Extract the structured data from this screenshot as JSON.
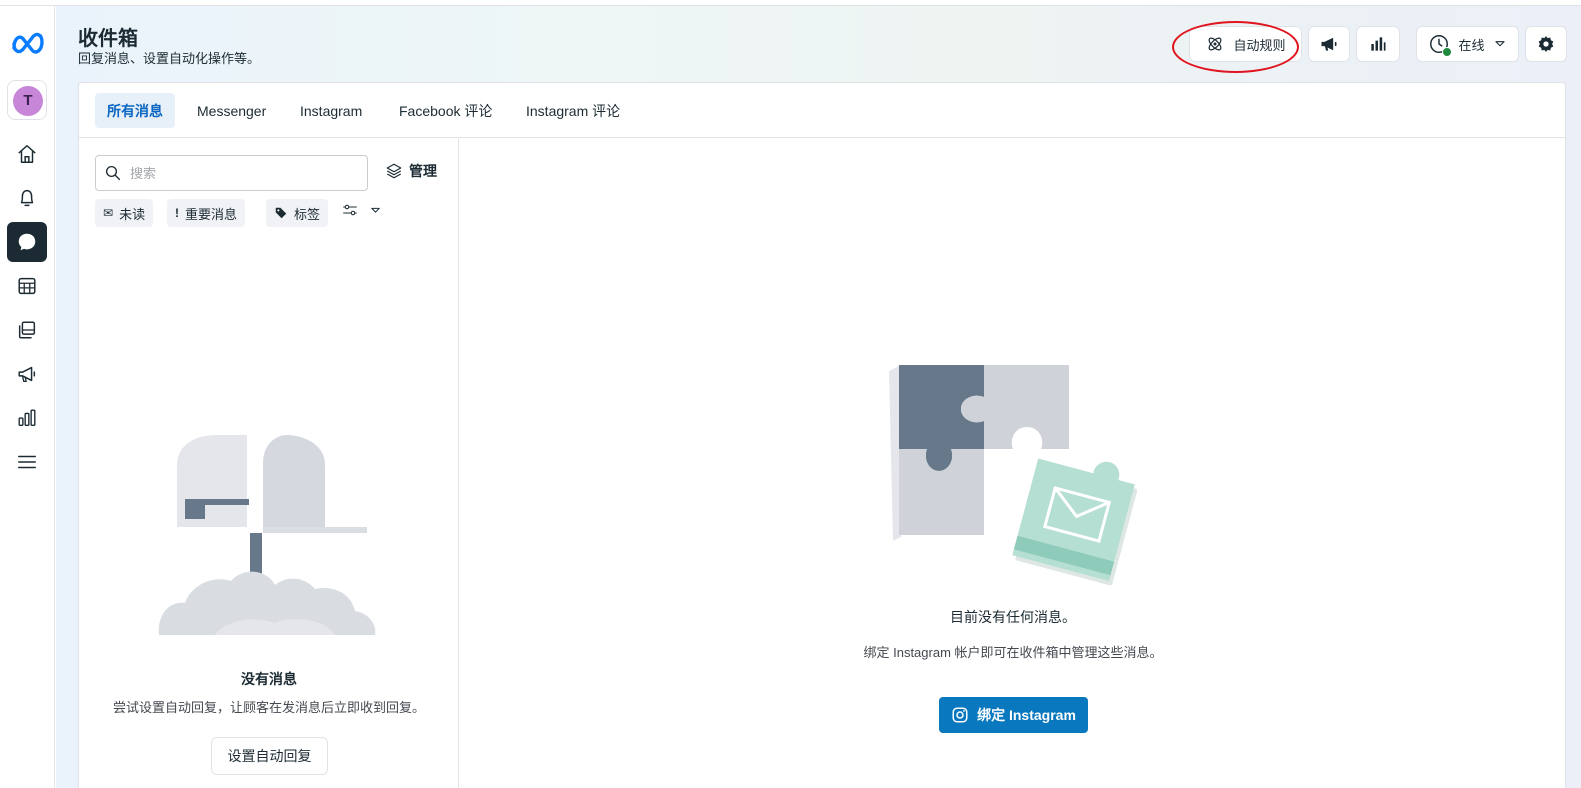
{
  "header": {
    "title": "收件箱",
    "subtitle": "回复消息、设置自动化操作等。",
    "automation_label": "自动规则",
    "status_label": "在线"
  },
  "sidebar": {
    "avatar_letter": "T",
    "items": [
      {
        "icon": "home-icon"
      },
      {
        "icon": "bell-icon"
      },
      {
        "icon": "inbox-chat-icon",
        "active": true
      },
      {
        "icon": "table-icon"
      },
      {
        "icon": "pages-icon"
      },
      {
        "icon": "megaphone-icon"
      },
      {
        "icon": "insights-icon"
      },
      {
        "icon": "menu-icon"
      }
    ]
  },
  "tabs": [
    {
      "label": "所有消息",
      "active": true
    },
    {
      "label": "Messenger"
    },
    {
      "label": "Instagram"
    },
    {
      "label": "Facebook 评论"
    },
    {
      "label": "Instagram 评论"
    }
  ],
  "list": {
    "search_placeholder": "搜索",
    "manage_label": "管理",
    "filters": [
      {
        "glyph": "✉",
        "label": "未读"
      },
      {
        "glyph": "!",
        "label": "重要消息"
      },
      {
        "glyph": "tag-icon",
        "label": "标签"
      }
    ],
    "empty_title": "没有消息",
    "empty_subtitle": "尝试设置自动回复，让顾客在发消息后立即收到回复。",
    "auto_reply_button": "设置自动回复"
  },
  "conversation": {
    "empty_title": "目前没有任何消息。",
    "empty_subtitle": "绑定 Instagram 帐户即可在收件箱中管理这些消息。",
    "bind_button": "绑定 Instagram"
  },
  "colors": {
    "primary": "#0a78be",
    "tab_active_bg": "#e7f0f9",
    "rail_active": "#1c2b33",
    "annotation": "#e0141e"
  }
}
